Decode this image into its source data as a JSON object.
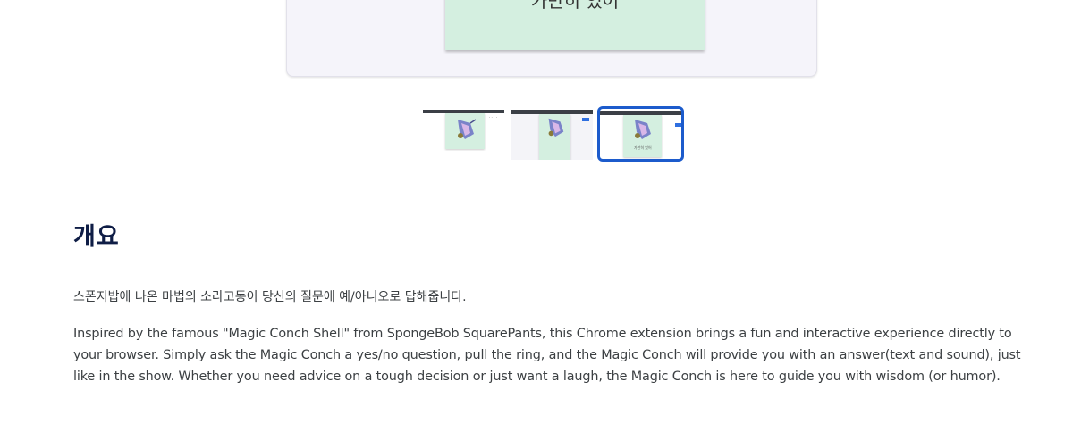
{
  "preview": {
    "answer_text": "가만히 있어"
  },
  "thumbnails": [
    {
      "label": "",
      "selected": false
    },
    {
      "label": "",
      "selected": false
    },
    {
      "label": "가만히 있어",
      "selected": true
    }
  ],
  "overview": {
    "title": "개요",
    "summary_ko": "스폰지밥에 나온 마법의 소라고동이 당신의 질문에 예/아니오로 답해줍니다.",
    "description_en": "Inspired by the famous \"Magic Conch Shell\" from SpongeBob SquarePants, this Chrome extension brings a fun and interactive experience directly to your browser. Simply ask the Magic Conch a yes/no question, pull the ring, and the Magic Conch will provide you with an answer(text and sound), just like in the show. Whether you need advice on a tough decision or just want a laugh, the Magic Conch is here to guide you with wisdom (or humor)."
  },
  "colors": {
    "selected_border": "#1c5bcc",
    "popup_green": "#d4efe0",
    "title_color": "#0f1d46"
  }
}
